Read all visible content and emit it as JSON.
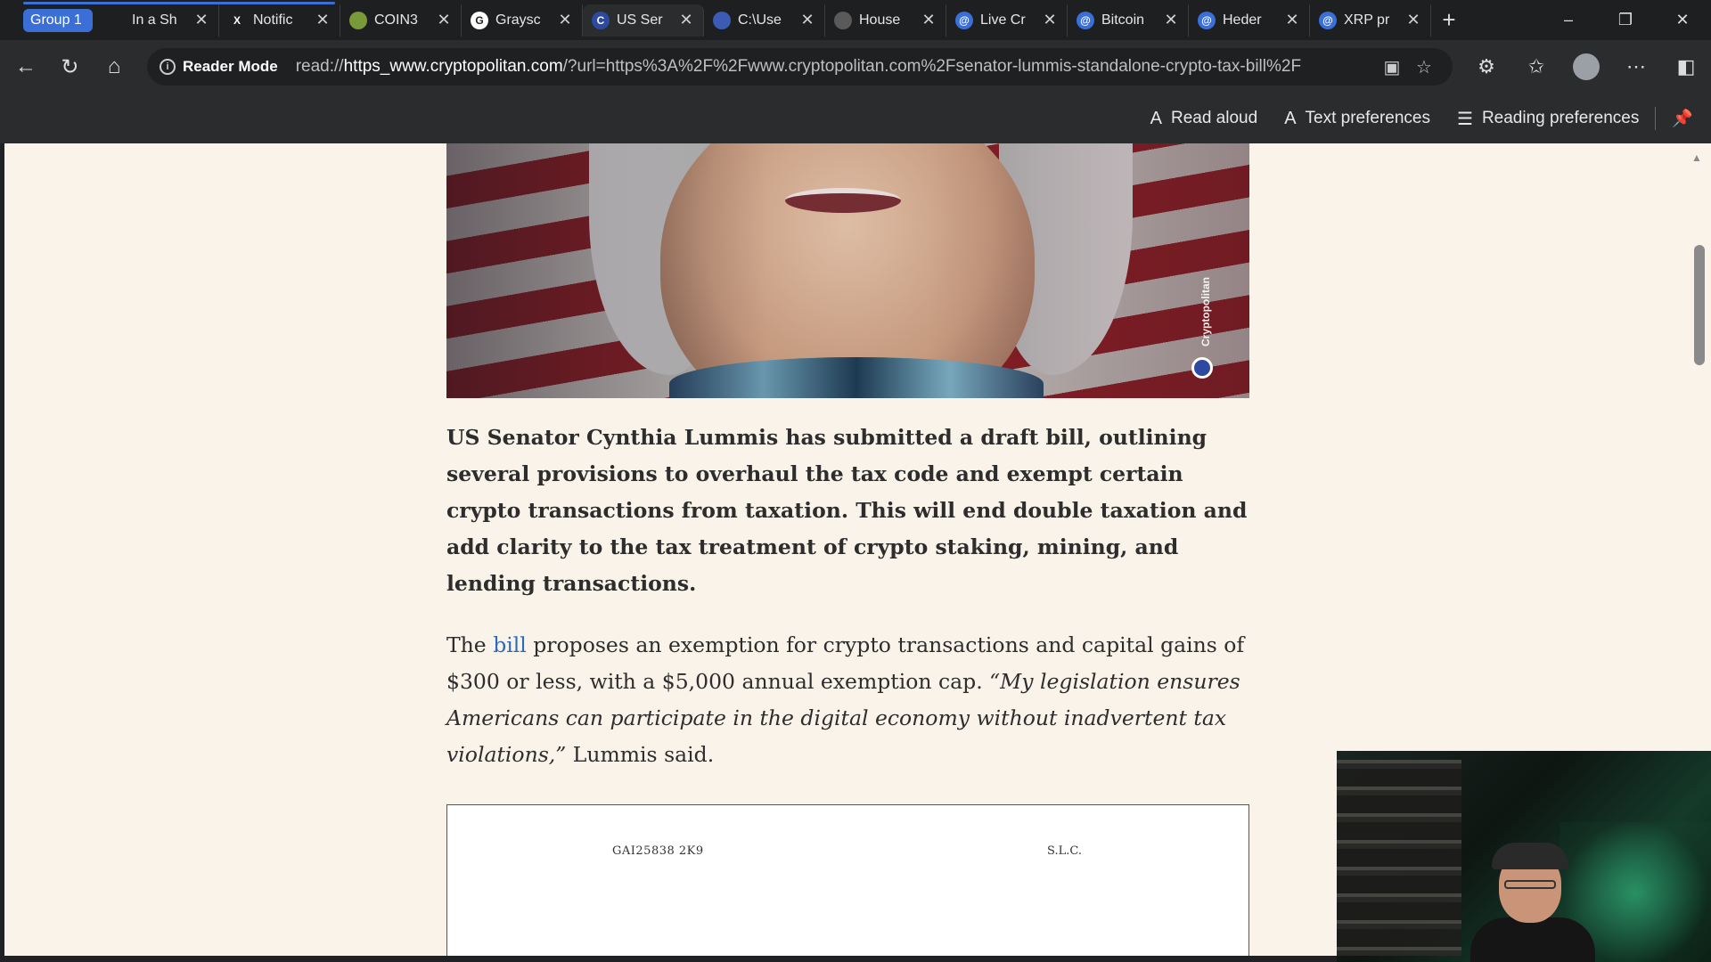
{
  "tabstrip": {
    "group_label": "Group 1",
    "tabs": [
      {
        "title": "In a Sh",
        "fav_color": "#1e1f20",
        "fav_glyph": ""
      },
      {
        "title": "Notific",
        "fav_color": "#1e1f20",
        "fav_glyph": "X"
      },
      {
        "title": "COIN3",
        "fav_color": "#7a9a3a",
        "fav_glyph": ""
      },
      {
        "title": "Graysc",
        "fav_color": "#ffffff",
        "fav_glyph": "G"
      },
      {
        "title": "US Ser",
        "fav_color": "#2e4aa0",
        "fav_glyph": "C"
      },
      {
        "title": "C:\\Use",
        "fav_color": "#3b5bb5",
        "fav_glyph": ""
      },
      {
        "title": "House",
        "fav_color": "#5a5a5a",
        "fav_glyph": ""
      },
      {
        "title": "Live Cr",
        "fav_color": "#3a6fd8",
        "fav_glyph": "@"
      },
      {
        "title": "Bitcoin",
        "fav_color": "#3a6fd8",
        "fav_glyph": "@"
      },
      {
        "title": "Heder",
        "fav_color": "#3a6fd8",
        "fav_glyph": "@"
      },
      {
        "title": "XRP pr",
        "fav_color": "#3a6fd8",
        "fav_glyph": "@"
      }
    ],
    "new_tab_glyph": "+",
    "window_controls": [
      "–",
      "❐",
      "✕"
    ]
  },
  "navbar": {
    "reader_mode_label": "Reader Mode",
    "url_prefix": "read://",
    "url_host": "https_www.cryptopolitan.com",
    "url_rest": "/?url=https%3A%2F%2Fwww.cryptopolitan.com%2Fsenator-lummis-standalone-crypto-tax-bill%2F"
  },
  "reader_bar": {
    "read_aloud": "Read aloud",
    "text_preferences": "Text preferences",
    "reading_preferences": "Reading preferences"
  },
  "hero": {
    "watermark": "Cryptopolitan"
  },
  "article": {
    "lead": "US Senator Cynthia Lummis has submitted a draft bill, outlining several provisions to overhaul the tax code and exempt certain crypto transactions from taxation. This will end double taxation and add clarity to the tax treatment of crypto staking, mining, and lending transactions.",
    "para_start": "The ",
    "para_link": "bill",
    "para_mid": " proposes an exemption for crypto transactions and capital gains of $300 or less, with a $5,000 annual exemption cap. ",
    "para_quote": "“My legislation ensures Americans can participate in the digital economy without inadvertent tax violations,”",
    "para_end": " Lummis said."
  },
  "document": {
    "left_code": "GAI25838  2K9",
    "right_code": "S.L.C."
  }
}
